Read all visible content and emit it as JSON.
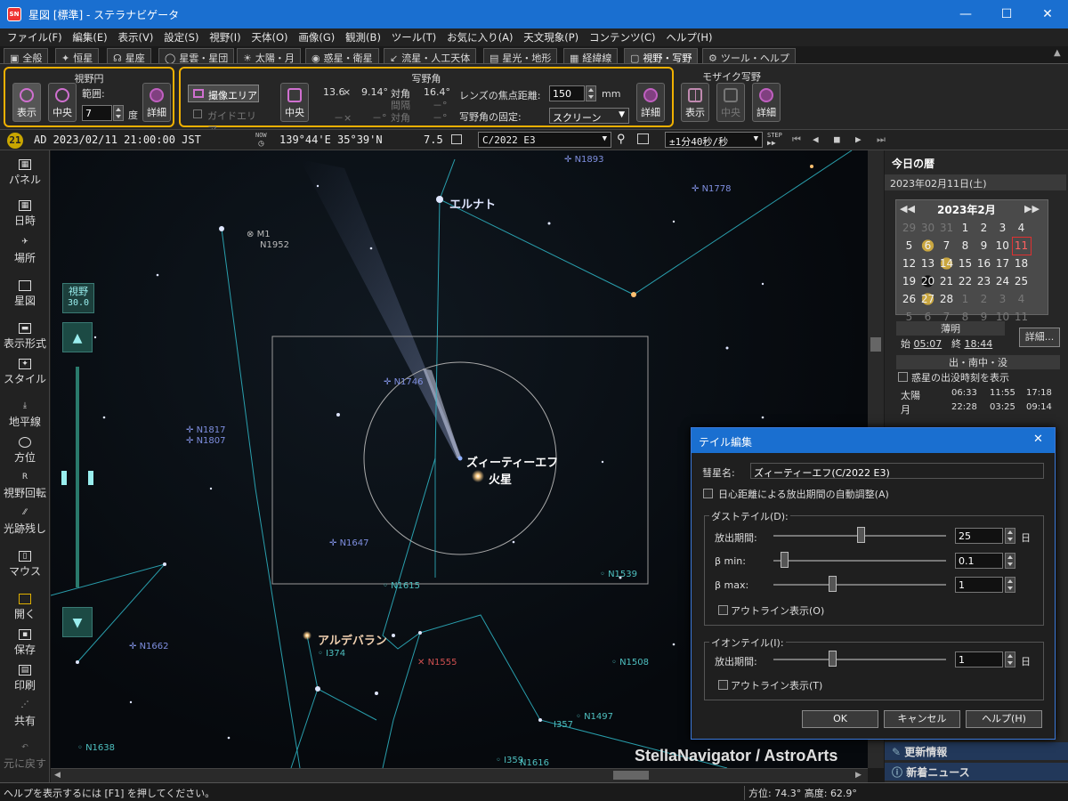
{
  "window": {
    "title": "星図 [標準] - ステラナビゲータ",
    "app_icon": "SN",
    "minimize": "—",
    "maximize": "☐",
    "close": "✕"
  },
  "menu": [
    "ファイル(F)",
    "編集(E)",
    "表示(V)",
    "設定(S)",
    "視野(I)",
    "天体(O)",
    "画像(G)",
    "観測(B)",
    "ツール(T)",
    "お気に入り(A)",
    "天文現象(P)",
    "コンテンツ(C)",
    "ヘルプ(H)"
  ],
  "tabs": [
    {
      "icon": "▣",
      "label": "全般"
    },
    {
      "icon": "✦",
      "label": "恒星"
    },
    {
      "icon": "☊",
      "label": "星座"
    },
    {
      "icon": "◯",
      "label": "星雲・星団"
    },
    {
      "icon": "☀",
      "label": "太陽・月"
    },
    {
      "icon": "◉",
      "label": "惑星・衛星"
    },
    {
      "icon": "↙",
      "label": "流星・人工天体"
    },
    {
      "icon": "▤",
      "label": "星光・地形"
    },
    {
      "icon": "▦",
      "label": "経緯線"
    },
    {
      "icon": "▢",
      "label": "視野・写野"
    },
    {
      "icon": "⚙",
      "label": "ツール・ヘルプ"
    }
  ],
  "ribbon": {
    "fov_group": {
      "title": "視野円",
      "show": "表示",
      "center": "中央",
      "range_label": "範囲:",
      "range_value": "7",
      "unit": "度",
      "detail": "詳細"
    },
    "photo_group": {
      "title": "写野角",
      "sensor_area": "撮像エリア",
      "guide_area": "ガイドエリア",
      "center": "中央",
      "val1": "13.6",
      "times": "×",
      "val2": "9.14°",
      "diag_label": "対角",
      "diag_value": "16.4°",
      "dash1": "－×",
      "dash2": "－°",
      "interval_label": "間隔",
      "interval_value": "－°",
      "diag2_label": "対角",
      "diag2_value": "－°",
      "focal_label": "レンズの焦点距離:",
      "focal_value": "150",
      "focal_unit": "mm",
      "fix_label": "写野角の固定:",
      "fix_value": "スクリーン",
      "detail": "詳細"
    },
    "mosaic_group": {
      "title": "モザイク写野",
      "show": "表示",
      "center": "中央",
      "detail": "詳細"
    }
  },
  "statusline": {
    "badge": "21",
    "datetime": "AD 2023/02/11 21:00:00 JST",
    "now": "NOW",
    "coords": "139°44'E 35°39'N",
    "mag": "7.5",
    "object": "C/2022 E3",
    "speed": "±1分40秒/秒",
    "step": "STEP"
  },
  "leftbar": [
    "パネル",
    "日時",
    "場所",
    "星図",
    "表示形式",
    "スタイル",
    "地平線",
    "方位",
    "視野回転",
    "光跡残し",
    "マウス",
    "開く",
    "保存",
    "印刷",
    "共有",
    "元に戻す"
  ],
  "fov_indicator": {
    "label": "視野",
    "value": "30.0"
  },
  "sky": {
    "labels": [
      {
        "t": "エルナト",
        "cls": "star"
      },
      {
        "t": "ズィーティーエフ",
        "cls": "star"
      },
      {
        "t": "火星",
        "cls": "star"
      },
      {
        "t": "アルデバラン",
        "cls": "star"
      },
      {
        "t": "N1893",
        "cls": "neb"
      },
      {
        "t": "N1778",
        "cls": "neb"
      },
      {
        "t": "M1",
        "cls": "grey"
      },
      {
        "t": "N1952",
        "cls": "grey"
      },
      {
        "t": "N1746",
        "cls": "neb"
      },
      {
        "t": "N1817",
        "cls": "neb"
      },
      {
        "t": "N1807",
        "cls": "neb"
      },
      {
        "t": "N1647",
        "cls": "neb"
      },
      {
        "t": "N1539",
        "cls": "neb"
      },
      {
        "t": "N1615",
        "cls": "neb"
      },
      {
        "t": "N1662",
        "cls": "neb"
      },
      {
        "t": "I374",
        "cls": "neb"
      },
      {
        "t": "N1555",
        "cls": "red"
      },
      {
        "t": "N1508",
        "cls": "neb"
      },
      {
        "t": "N1497",
        "cls": "neb"
      },
      {
        "t": "I357",
        "cls": "neb"
      },
      {
        "t": "N1638",
        "cls": "neb"
      },
      {
        "t": "I359",
        "cls": "neb"
      },
      {
        "t": "N1616",
        "cls": "neb"
      }
    ],
    "watermark": "StellaNavigator / AstroArts"
  },
  "rpanel": {
    "title": "今日の暦",
    "date": "2023年02月11日(土)",
    "month": "2023年2月",
    "weeks": [
      [
        "29",
        "30",
        "31",
        "1",
        "2",
        "3",
        "4"
      ],
      [
        "5",
        "6",
        "7",
        "8",
        "9",
        "10",
        "11"
      ],
      [
        "12",
        "13",
        "14",
        "15",
        "16",
        "17",
        "18"
      ],
      [
        "19",
        "20",
        "21",
        "22",
        "23",
        "24",
        "25"
      ],
      [
        "26",
        "27",
        "28",
        "1",
        "2",
        "3",
        "4"
      ],
      [
        "5",
        "6",
        "7",
        "8",
        "9",
        "10",
        "11"
      ]
    ],
    "twilight": "薄明",
    "start_label": "始",
    "start": "05:07",
    "end_label": "終",
    "end": "18:44",
    "detail": "詳細...",
    "rise_title": "出・南中・没",
    "planet_check": "惑星の出没時刻を表示",
    "sun": {
      "name": "太陽",
      "rise": "06:33",
      "transit": "11:55",
      "set": "17:18"
    },
    "moon": {
      "name": "月",
      "rise": "22:28",
      "transit": "03:25",
      "set": "09:14"
    },
    "news1": "更新情報",
    "news2": "新着ニュース"
  },
  "dialog": {
    "title": "テイル編集",
    "close": "✕",
    "comet_label": "彗星名:",
    "comet_value": "ズィーティーエフ(C/2022 E3)",
    "auto": "日心距離による放出期間の自動調整(A)",
    "dust": {
      "title": "ダストテイル(D):",
      "period_label": "放出期間:",
      "period_value": "25",
      "period_unit": "日",
      "bmin_label": "β min:",
      "bmin_value": "0.1",
      "bmax_label": "β max:",
      "bmax_value": "1",
      "outline": "アウトライン表示(O)"
    },
    "ion": {
      "title": "イオンテイル(I):",
      "period_label": "放出期間:",
      "period_value": "1",
      "period_unit": "日",
      "outline": "アウトライン表示(T)"
    },
    "ok": "OK",
    "cancel": "キャンセル",
    "help": "ヘルプ(H)"
  },
  "bottombar": {
    "help": "ヘルプを表示するには [F1] を押してください。",
    "azimuth_label": "方位:",
    "azimuth": "74.3°",
    "altitude_label": "高度:",
    "altitude": "62.9°"
  }
}
